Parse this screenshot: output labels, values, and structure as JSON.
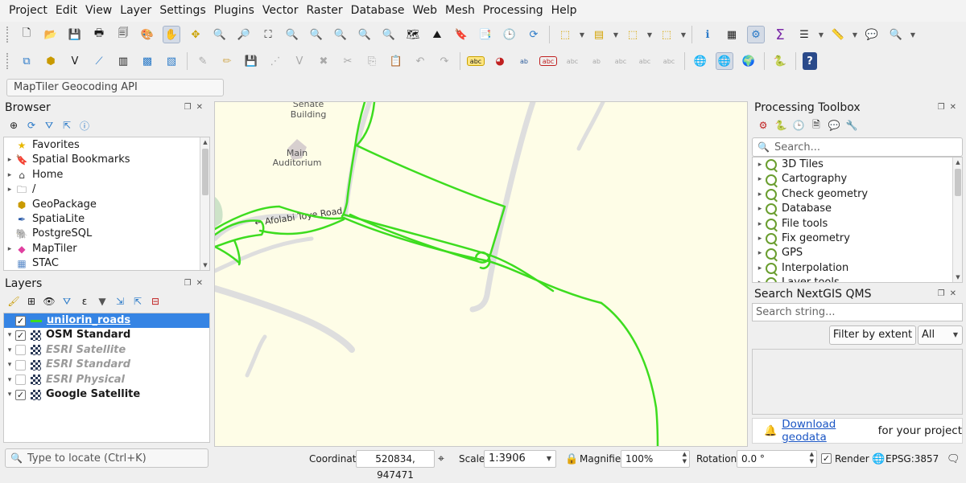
{
  "menubar": {
    "items": [
      "Project",
      "Edit",
      "View",
      "Layer",
      "Settings",
      "Plugins",
      "Vector",
      "Raster",
      "Database",
      "Web",
      "Mesh",
      "Processing",
      "Help"
    ]
  },
  "geocoding": {
    "placeholder": "MapTiler Geocoding API"
  },
  "browser": {
    "title": "Browser",
    "items": [
      {
        "label": "Favorites",
        "icon": "star-icon",
        "expandable": false
      },
      {
        "label": "Spatial Bookmarks",
        "icon": "bookmark-icon",
        "expandable": true
      },
      {
        "label": "Home",
        "icon": "home-folder-icon",
        "expandable": true
      },
      {
        "label": "/",
        "icon": "folder-icon",
        "expandable": true
      },
      {
        "label": "GeoPackage",
        "icon": "geopackage-icon",
        "expandable": false
      },
      {
        "label": "SpatiaLite",
        "icon": "spatialite-icon",
        "expandable": false
      },
      {
        "label": "PostgreSQL",
        "icon": "postgresql-icon",
        "expandable": false
      },
      {
        "label": "MapTiler",
        "icon": "maptiler-icon",
        "expandable": true
      },
      {
        "label": "STAC",
        "icon": "stac-icon",
        "expandable": false
      }
    ]
  },
  "layers": {
    "title": "Layers",
    "items": [
      {
        "label": "unilorin_roads",
        "checked": true,
        "selected": true,
        "greyed": false,
        "expandable": false,
        "color": "#3ddc1f"
      },
      {
        "label": "OSM Standard",
        "checked": true,
        "selected": false,
        "greyed": false,
        "expandable": true
      },
      {
        "label": "ESRI Satellite",
        "checked": false,
        "selected": false,
        "greyed": true,
        "expandable": true
      },
      {
        "label": "ESRI Standard",
        "checked": false,
        "selected": false,
        "greyed": true,
        "expandable": true
      },
      {
        "label": "ESRI Physical",
        "checked": false,
        "selected": false,
        "greyed": true,
        "expandable": true
      },
      {
        "label": "Google Satellite",
        "checked": true,
        "selected": false,
        "greyed": false,
        "expandable": true
      }
    ]
  },
  "map": {
    "labels": {
      "senate": "Senate Building",
      "auditorium": "Main Auditorium",
      "road": "Afolabi Toye Road"
    },
    "colors": {
      "background": "#fefde7",
      "road": "#3ddc1f",
      "footway": "#dedede"
    }
  },
  "processing_toolbox": {
    "title": "Processing Toolbox",
    "search_placeholder": "Search...",
    "items": [
      "3D Tiles",
      "Cartography",
      "Check geometry",
      "Database",
      "File tools",
      "Fix geometry",
      "GPS",
      "Interpolation",
      "Layer tools"
    ]
  },
  "nextgis": {
    "title": "Search NextGIS QMS",
    "search_placeholder": "Search string...",
    "filter_button": "Filter by extent",
    "filter_select": "All",
    "footer_link": "Download geodata",
    "footer_text": " for your project"
  },
  "statusbar": {
    "locate_placeholder": "Type to locate (Ctrl+K)",
    "coordinate_label": "Coordinate",
    "coordinate_value": "520834, 947471",
    "scale_label": "Scale",
    "scale_value": "1:3906",
    "magnifier_label": "Magnifier",
    "magnifier_value": "100%",
    "rotation_label": "Rotation",
    "rotation_value": "0.0 °",
    "render_label": "Render",
    "render_checked": true,
    "crs": "EPSG:3857"
  }
}
